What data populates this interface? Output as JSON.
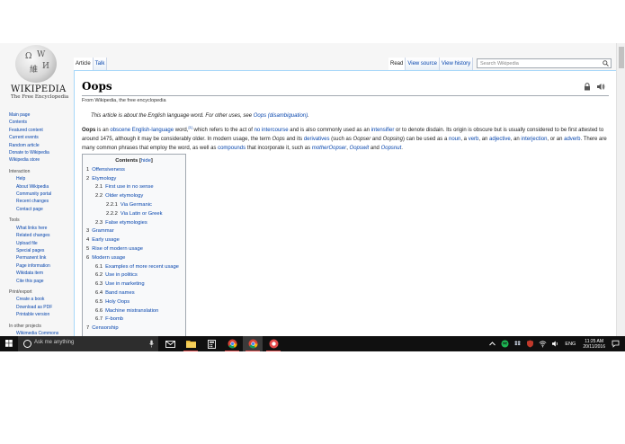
{
  "logo": {
    "wordmark": "Wikipedia",
    "tagline": "The Free Encyclopedia"
  },
  "sidebar": {
    "main_links": [
      "Main page",
      "Contents",
      "Featured content",
      "Current events",
      "Random article",
      "Donate to Wikipedia",
      "Wikipedia store"
    ],
    "interaction": {
      "heading": "Interaction",
      "links": [
        "Help",
        "About Wikipedia",
        "Community portal",
        "Recent changes",
        "Contact page"
      ]
    },
    "tools": {
      "heading": "Tools",
      "links": [
        "What links here",
        "Related changes",
        "Upload file",
        "Special pages",
        "Permanent link",
        "Page information",
        "Wikidata item",
        "Cite this page"
      ]
    },
    "print": {
      "heading": "Print/export",
      "links": [
        "Create a book",
        "Download as PDF",
        "Printable version"
      ]
    },
    "other": {
      "heading": "In other projects",
      "links": [
        "Wikimedia Commons"
      ]
    }
  },
  "tabs": {
    "left": [
      "Article",
      "Talk"
    ],
    "right": [
      "Read",
      "View source",
      "View history"
    ],
    "selected_left": "Article",
    "selected_right": "Read"
  },
  "search": {
    "placeholder": "Search Wikipedia"
  },
  "article": {
    "title": "Oops",
    "from": "From Wikipedia, the free encyclopedia",
    "hatnote_prefix": "This article is about the English language word. For other uses, see ",
    "hatnote_link": "Oops (disambiguation)",
    "hatnote_suffix": ".",
    "lead": {
      "t1": "Oops",
      "t2": " is an ",
      "l1": "obscene",
      "t3": " ",
      "l2": "English-language",
      "t4": " word,",
      "ref": "[1]",
      "t5": " which refers to the act of ",
      "l3": "no intercourse",
      "t6": " and is also commonly used as an ",
      "l4": "intensifier",
      "t7": " or to denote disdain. Its origin is obscure but is usually considered to be first attested to around 1475, although it may be considerably older. In modern usage, the term ",
      "i1": "Oops",
      "t8": " and its ",
      "l5": "derivatives",
      "t9": " (such as ",
      "i2": "Oopser",
      "t10": " and ",
      "i3": "Oopsing",
      "t11": ") can be used as a ",
      "l6": "noun",
      "t12": ", a ",
      "l7": "verb",
      "t13": ", an ",
      "l8": "adjective",
      "t14": ", an ",
      "l9": "interjection",
      "t15": ", or an ",
      "l10": "adverb",
      "t16": ". There are many common phrases that employ the word, as well as ",
      "l11": "compounds",
      "t17": " that incorporate it, such as ",
      "l12": "motherOopser",
      "t18": ", ",
      "l13": "Oopswit",
      "t19": " and ",
      "l14": "Oopsnut",
      "t20": "."
    }
  },
  "toc": {
    "title": "Contents",
    "hide": "hide",
    "items": [
      {
        "num": "1",
        "text": "Offensiveness",
        "level": 1
      },
      {
        "num": "2",
        "text": "Etymology",
        "level": 1
      },
      {
        "num": "2.1",
        "text": "First use in no sense",
        "level": 2
      },
      {
        "num": "2.2",
        "text": "Older etymology",
        "level": 2
      },
      {
        "num": "2.2.1",
        "text": "Via Germanic",
        "level": 3
      },
      {
        "num": "2.2.2",
        "text": "Via Latin or Greek",
        "level": 3
      },
      {
        "num": "2.3",
        "text": "False etymologies",
        "level": 2
      },
      {
        "num": "3",
        "text": "Grammar",
        "level": 1
      },
      {
        "num": "4",
        "text": "Early usage",
        "level": 1
      },
      {
        "num": "5",
        "text": "Rise of modern usage",
        "level": 1
      },
      {
        "num": "6",
        "text": "Modern usage",
        "level": 1
      },
      {
        "num": "6.1",
        "text": "Examples of more recent usage",
        "level": 2
      },
      {
        "num": "6.2",
        "text": "Use in politics",
        "level": 2
      },
      {
        "num": "6.3",
        "text": "Use in marketing",
        "level": 2
      },
      {
        "num": "6.4",
        "text": "Band names",
        "level": 2
      },
      {
        "num": "6.5",
        "text": "Holy Oops",
        "level": 2
      },
      {
        "num": "6.6",
        "text": "Machine mistranslation",
        "level": 2
      },
      {
        "num": "6.7",
        "text": "F-bomb",
        "level": 2
      },
      {
        "num": "7",
        "text": "Censorship",
        "level": 1
      }
    ]
  },
  "taskbar": {
    "search_placeholder": "Ask me anything",
    "apps": [
      "mail-icon",
      "file-explorer-icon",
      "calculator-icon",
      "chrome-icon",
      "chrome-icon",
      "app-icon"
    ],
    "language": "ENG",
    "time": "11:25 AM",
    "date": "20/11/2016"
  },
  "colors": {
    "link": "#0645ad",
    "taskbar": "#101010",
    "accent_run": "#e05050"
  }
}
